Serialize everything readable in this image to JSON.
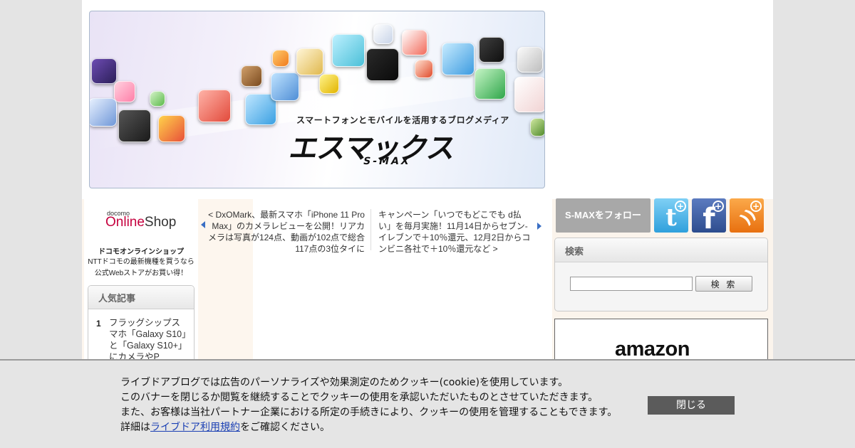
{
  "banner": {
    "tagline": "スマートフォンとモバイルを活用するブログメディア",
    "logo": "エスマックス",
    "sublogo": "S-MAX"
  },
  "sidebar_left": {
    "docomo_small": "docomo",
    "docomo_shop_online": "Online",
    "docomo_shop_shop": "Shop",
    "promo_title": "ドコモオンラインショップ",
    "promo_line1": "NTTドコモの最新機種を買うなら",
    "promo_line2": "公式Webストアがお買い得！",
    "popular": {
      "heading": "人気記事",
      "items": [
        {
          "rank": "1",
          "title": "フラッグシップスマホ「Galaxy S10」と「Galaxy S10+」にカメラやP"
        }
      ]
    }
  },
  "article_nav": {
    "prev": "< DxOMark、最新スマホ「iPhone 11 Pro Max」のカメラレビューを公開！リアカメラは写真が124点、動画が102点で総合117点の3位タイに",
    "next": "キャンペーン「いつでもどこでも d払い」を毎月実施！11月14日からセブン‐イレブンで＋10％還元、12月2日からコンビニ各社で＋10％還元など >"
  },
  "sidebar_right": {
    "follow_label": "S-MAXをフォロー",
    "social": [
      {
        "name": "twitter",
        "glyph": "t"
      },
      {
        "name": "facebook",
        "glyph": "f"
      },
      {
        "name": "rss",
        "glyph": "))"
      }
    ],
    "social_plus": "+",
    "search": {
      "heading": "検索",
      "input_value": "",
      "button_label": "検 索"
    },
    "amazon_logo": "amazon"
  },
  "cookie": {
    "line1": "ライブドアブログでは広告のパーソナライズや効果測定のためクッキー(cookie)を使用しています。",
    "line2": "このバナーを閉じるか閲覧を継続することでクッキーの使用を承認いただいたものとさせていただきます。",
    "line3": "また、お客様は当社パートナー企業における所定の手続きにより、クッキーの使用を管理することもできます。",
    "line4_prefix": "詳細は",
    "line4_link": "ライブドア利用規約",
    "line4_suffix": "をご確認ください。",
    "close_label": "閉じる"
  },
  "colors": {
    "docomo_red": "#c5003e",
    "link_blue": "#1a3fb3",
    "twitter": "#2fa0dc",
    "facebook": "#2e4d8e",
    "rss": "#e8700f"
  }
}
